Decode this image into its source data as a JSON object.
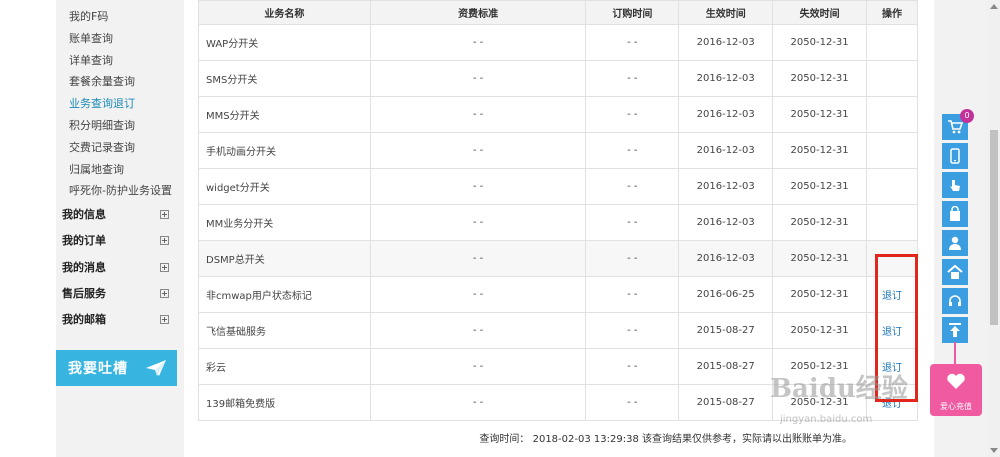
{
  "sidebar": {
    "sub_items": [
      "我的F码",
      "账单查询",
      "详单查询",
      "套餐余量查询",
      "业务查询退订",
      "积分明细查询",
      "交费记录查询",
      "归属地查询",
      "呼死你-防护业务设置"
    ],
    "active_index": 4,
    "groups": [
      "我的信息",
      "我的订单",
      "我的消息",
      "售后服务",
      "我的邮箱"
    ],
    "feedback_label": "我要吐槽"
  },
  "table": {
    "headers": [
      "业务名称",
      "资费标准",
      "订购时间",
      "生效时间",
      "失效时间",
      "操作"
    ],
    "rows": [
      {
        "name": "WAP分开关",
        "fee": "- -",
        "order": "- -",
        "start": "2016-12-03",
        "end": "2050-12-31",
        "action": ""
      },
      {
        "name": "SMS分开关",
        "fee": "- -",
        "order": "- -",
        "start": "2016-12-03",
        "end": "2050-12-31",
        "action": ""
      },
      {
        "name": "MMS分开关",
        "fee": "- -",
        "order": "- -",
        "start": "2016-12-03",
        "end": "2050-12-31",
        "action": ""
      },
      {
        "name": "手机动画分开关",
        "fee": "- -",
        "order": "- -",
        "start": "2016-12-03",
        "end": "2050-12-31",
        "action": ""
      },
      {
        "name": "widget分开关",
        "fee": "- -",
        "order": "- -",
        "start": "2016-12-03",
        "end": "2050-12-31",
        "action": ""
      },
      {
        "name": "MM业务分开关",
        "fee": "- -",
        "order": "- -",
        "start": "2016-12-03",
        "end": "2050-12-31",
        "action": ""
      },
      {
        "name": "DSMP总开关",
        "fee": "- -",
        "order": "- -",
        "start": "2016-12-03",
        "end": "2050-12-31",
        "action": ""
      },
      {
        "name": "非cmwap用户状态标记",
        "fee": "- -",
        "order": "- -",
        "start": "2016-06-25",
        "end": "2050-12-31",
        "action": "退订"
      },
      {
        "name": "飞信基础服务",
        "fee": "- -",
        "order": "- -",
        "start": "2015-08-27",
        "end": "2050-12-31",
        "action": "退订"
      },
      {
        "name": "彩云",
        "fee": "- -",
        "order": "- -",
        "start": "2015-08-27",
        "end": "2050-12-31",
        "action": "退订"
      },
      {
        "name": "139邮箱免费版",
        "fee": "- -",
        "order": "- -",
        "start": "2015-08-27",
        "end": "2050-12-31",
        "action": "退订"
      }
    ]
  },
  "footer_note": "查询时间： 2018-02-03 13:29:38 该查询结果仅供参考，实际请以出账账单为准。",
  "float_bar": {
    "cart_count": "0",
    "charity_label": "爱心充值"
  },
  "watermark": {
    "brand": "Baidu经验",
    "url": "jingyan.baidu.com"
  },
  "colors": {
    "accent": "#1a8ab5",
    "float_button": "#3a9ee0",
    "highlight_box": "#e1261c",
    "feedback_bg": "#37b4e0",
    "charity_bg": "#f05aa0"
  }
}
